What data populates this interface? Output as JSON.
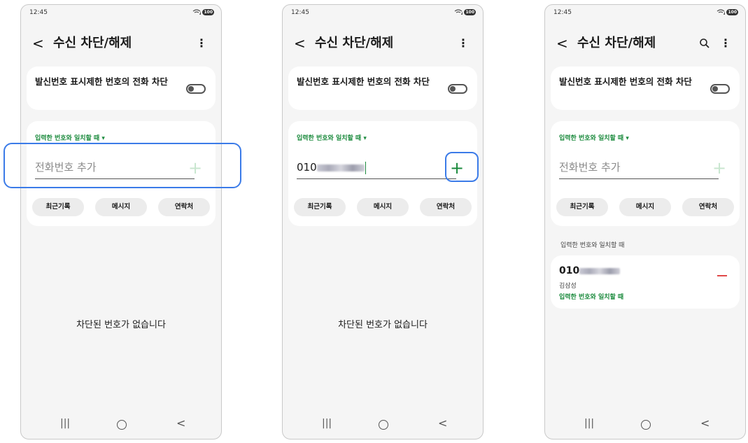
{
  "status": {
    "time": "12:45",
    "battery": "100"
  },
  "header": {
    "title": "수신 차단/해제"
  },
  "toggle": {
    "label": "발신번호 표시제한 번호의 전화 차단",
    "on": false
  },
  "match_rule": "입력한 번호와 일치할 때 ▾",
  "input": {
    "placeholder": "전화번호 추가",
    "typed_prefix": "010"
  },
  "chips": [
    "최근기록",
    "메시지",
    "연락처"
  ],
  "empty_message": "차단된 번호가 없습니다",
  "blocked_section": {
    "label": "입력한 번호와 일치할 때"
  },
  "blocked_entry": {
    "number_prefix": "010",
    "name": "김삼성",
    "rule": "입력한 번호와 일치할 때"
  },
  "colors": {
    "accent_green": "#1a8a3c",
    "highlight_blue": "#3b7be8",
    "remove_red": "#e04848"
  }
}
